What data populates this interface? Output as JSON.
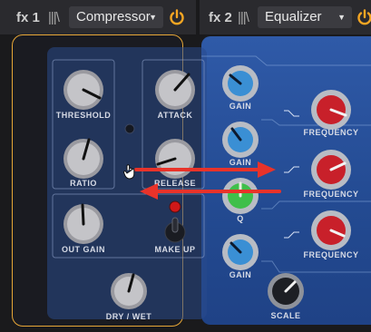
{
  "slot1": {
    "label": "fx 1",
    "grip": "|||\\",
    "effect": "Compressor",
    "active_color": "#f5a623"
  },
  "slot2": {
    "label": "fx 2",
    "grip": "|||\\",
    "effect": "Equalizer"
  },
  "compressor": {
    "threshold": "THRESHOLD",
    "ratio": "RATIO",
    "attack": "ATTACK",
    "release": "RELEASE",
    "out_gain": "OUT GAIN",
    "make_up": "MAKE UP",
    "dry_wet": "DRY / WET"
  },
  "equalizer": {
    "gain1": "GAIN",
    "gain2": "GAIN",
    "q": "Q",
    "gain3": "GAIN",
    "freq1": "FREQUENCY",
    "freq2": "FREQUENCY",
    "freq3": "FREQUENCY",
    "scale": "SCALE"
  },
  "colors": {
    "panel_blue": "#2a4f96",
    "gain_blue": "#3a8fd4",
    "q_green": "#3fbf4a",
    "freq_red": "#c8202a",
    "arrow_red": "#e8332a",
    "led_red": "#d01818"
  }
}
